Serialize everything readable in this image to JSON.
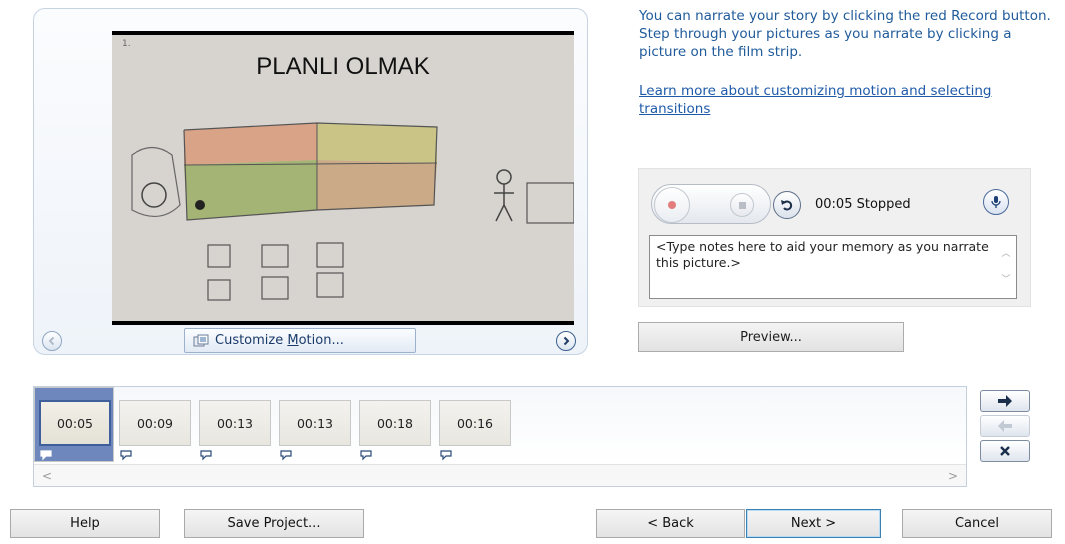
{
  "preview": {
    "slide_number": "1.",
    "slide_title": "PLANLI OLMAK",
    "customize_prefix": "Customize ",
    "customize_accel": "M",
    "customize_suffix": "otion..."
  },
  "instructions": {
    "text": "You can narrate your story by clicking the red Record button. Step through your pictures as you narrate by clicking a picture on the film strip.",
    "link": "Learn more about customizing motion and selecting transitions"
  },
  "narration": {
    "time": "00:05",
    "status": "Stopped",
    "notes": "<Type notes here to aid your memory as you narrate this picture.>"
  },
  "preview_button": "Preview...",
  "filmstrip": {
    "frames": [
      {
        "duration": "00:05",
        "selected": true
      },
      {
        "duration": "00:09",
        "selected": false
      },
      {
        "duration": "00:13",
        "selected": false
      },
      {
        "duration": "00:13",
        "selected": false
      },
      {
        "duration": "00:18",
        "selected": false
      },
      {
        "duration": "00:16",
        "selected": false
      }
    ],
    "scroll_left": "<",
    "scroll_right": ">"
  },
  "buttons": {
    "help": "Help",
    "save_project": "Save Project...",
    "back": "< Back",
    "next": "Next >",
    "cancel": "Cancel"
  },
  "colors": {
    "accent": "#1f5a9a",
    "selected_frame": "#6e88bd",
    "record_dot": "#e37d7d"
  }
}
